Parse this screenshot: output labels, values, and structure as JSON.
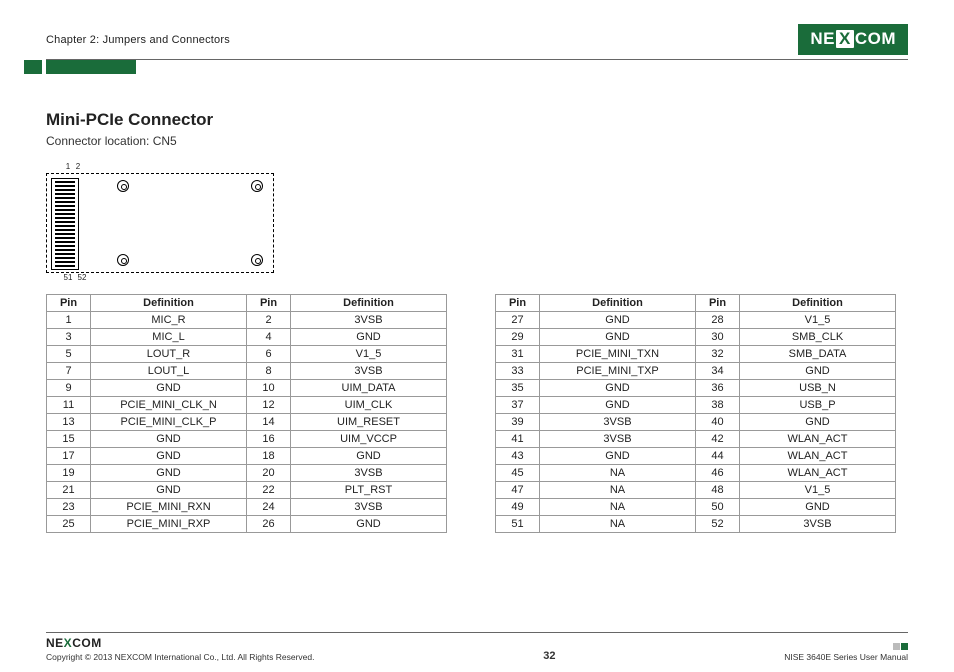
{
  "header": {
    "chapter": "Chapter 2: Jumpers and Connectors",
    "logo_pre": "NE",
    "logo_x": "X",
    "logo_post": "COM"
  },
  "section": {
    "title": "Mini-PCIe Connector",
    "subtitle": "Connector location: CN5"
  },
  "diagram": {
    "lbl1": "1",
    "lbl2": "2",
    "lbl51": "51",
    "lbl52": "52"
  },
  "table_headers": {
    "pin": "Pin",
    "def": "Definition"
  },
  "table_left": [
    {
      "p1": "1",
      "d1": "MIC_R",
      "p2": "2",
      "d2": "3VSB"
    },
    {
      "p1": "3",
      "d1": "MIC_L",
      "p2": "4",
      "d2": "GND"
    },
    {
      "p1": "5",
      "d1": "LOUT_R",
      "p2": "6",
      "d2": "V1_5"
    },
    {
      "p1": "7",
      "d1": "LOUT_L",
      "p2": "8",
      "d2": "3VSB"
    },
    {
      "p1": "9",
      "d1": "GND",
      "p2": "10",
      "d2": "UIM_DATA"
    },
    {
      "p1": "11",
      "d1": "PCIE_MINI_CLK_N",
      "p2": "12",
      "d2": "UIM_CLK"
    },
    {
      "p1": "13",
      "d1": "PCIE_MINI_CLK_P",
      "p2": "14",
      "d2": "UIM_RESET"
    },
    {
      "p1": "15",
      "d1": "GND",
      "p2": "16",
      "d2": "UIM_VCCP"
    },
    {
      "p1": "17",
      "d1": "GND",
      "p2": "18",
      "d2": "GND"
    },
    {
      "p1": "19",
      "d1": "GND",
      "p2": "20",
      "d2": "3VSB"
    },
    {
      "p1": "21",
      "d1": "GND",
      "p2": "22",
      "d2": "PLT_RST"
    },
    {
      "p1": "23",
      "d1": "PCIE_MINI_RXN",
      "p2": "24",
      "d2": "3VSB"
    },
    {
      "p1": "25",
      "d1": "PCIE_MINI_RXP",
      "p2": "26",
      "d2": "GND"
    }
  ],
  "table_right": [
    {
      "p1": "27",
      "d1": "GND",
      "p2": "28",
      "d2": "V1_5"
    },
    {
      "p1": "29",
      "d1": "GND",
      "p2": "30",
      "d2": "SMB_CLK"
    },
    {
      "p1": "31",
      "d1": "PCIE_MINI_TXN",
      "p2": "32",
      "d2": "SMB_DATA"
    },
    {
      "p1": "33",
      "d1": "PCIE_MINI_TXP",
      "p2": "34",
      "d2": "GND"
    },
    {
      "p1": "35",
      "d1": "GND",
      "p2": "36",
      "d2": "USB_N"
    },
    {
      "p1": "37",
      "d1": "GND",
      "p2": "38",
      "d2": "USB_P"
    },
    {
      "p1": "39",
      "d1": "3VSB",
      "p2": "40",
      "d2": "GND"
    },
    {
      "p1": "41",
      "d1": "3VSB",
      "p2": "42",
      "d2": "WLAN_ACT"
    },
    {
      "p1": "43",
      "d1": "GND",
      "p2": "44",
      "d2": "WLAN_ACT"
    },
    {
      "p1": "45",
      "d1": "NA",
      "p2": "46",
      "d2": "WLAN_ACT"
    },
    {
      "p1": "47",
      "d1": "NA",
      "p2": "48",
      "d2": "V1_5"
    },
    {
      "p1": "49",
      "d1": "NA",
      "p2": "50",
      "d2": "GND"
    },
    {
      "p1": "51",
      "d1": "NA",
      "p2": "52",
      "d2": "3VSB"
    }
  ],
  "footer": {
    "logo_pre": "NE",
    "logo_x": "X",
    "logo_post": "COM",
    "copyright": "Copyright © 2013 NEXCOM International Co., Ltd. All Rights Reserved.",
    "page": "32",
    "manual": "NISE 3640E Series User Manual"
  }
}
